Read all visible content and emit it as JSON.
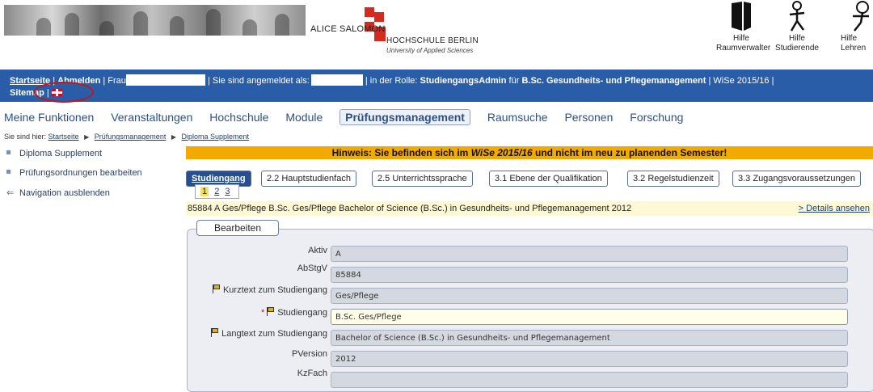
{
  "banner": {
    "logo_line1": "ALICE SALOMON",
    "logo_line2": "HOCHSCHULE BERLIN",
    "logo_line3": "University of Applied Sciences",
    "help_links": [
      {
        "line1": "Hilfe",
        "line2": "Raumverwalter",
        "icon": "raum-help-icon"
      },
      {
        "line1": "Hilfe",
        "line2": "Studierende",
        "icon": "student-help-icon"
      },
      {
        "line1": "Hilfe",
        "line2": "Lehren",
        "icon": "teacher-help-icon"
      }
    ]
  },
  "topbar": {
    "startseite": "Startseite",
    "sep": "|",
    "abmelden": "Abmelden",
    "frau": "Frau",
    "angemeldet": "Sie sind angemeldet als:",
    "rolle_prefix": "in der Rolle:",
    "rolle": "StudiengangsAdmin",
    "fuer": "für",
    "studiengang": "B.Sc. Gesundheits- und Pflegemanagement",
    "semester": "WiSe 2015/16",
    "sitemap": "Sitemap"
  },
  "mainnav": [
    "Meine Funktionen",
    "Veranstaltungen",
    "Hochschule",
    "Module",
    "Prüfungsmanagement",
    "Raumsuche",
    "Personen",
    "Forschung"
  ],
  "breadcrumb": {
    "prefix": "Sie sind hier:",
    "items": [
      "Startseite",
      "Prüfungsmanagement",
      "Diploma Supplement"
    ]
  },
  "sidebar": [
    {
      "label": "Diploma Supplement",
      "icon": "bullet-icon"
    },
    {
      "label": "Prüfungsordnungen bearbeiten",
      "icon": "bullet-icon"
    },
    {
      "label": "Navigation ausblenden",
      "icon": "arrow-left-icon"
    }
  ],
  "notice": {
    "prefix": "Hinweis: Sie befinden sich im",
    "semester": "WiSe 2015/16",
    "suffix": "und nicht im neu zu planenden Semester!"
  },
  "tabs": [
    "Studiengang",
    "2.2 Hauptstudienfach",
    "2.5 Unterrichtssprache",
    "3.1 Ebene der Qualifikation",
    "3.2 Regelstudienzeit",
    "3.3 Zugangsvoraussetzungen"
  ],
  "pager": [
    "1",
    "2",
    "3"
  ],
  "record": {
    "summary": "85884  A  Ges/Pflege  B.Sc. Ges/Pflege  Bachelor of Science (B.Sc.) in Gesundheits- und Pflegemanagement  2012",
    "details_link": "Details ansehen"
  },
  "form": {
    "edit_button": "Bearbeiten",
    "fields": [
      {
        "label": "Aktiv",
        "value": "A"
      },
      {
        "label": "AbStgV",
        "value": "85884"
      },
      {
        "label": "Kurztext zum Studiengang",
        "value": "Ges/Pflege"
      },
      {
        "label": "Studiengang",
        "value": "B.Sc. Ges/Pflege",
        "required": "*"
      },
      {
        "label": "Langtext zum Studiengang",
        "value": "Bachelor of Science (B.Sc.) in Gesundheits- und Pflegemanagement"
      },
      {
        "label": "PVersion",
        "value": "2012"
      },
      {
        "label": "KzFach",
        "value": ""
      }
    ]
  },
  "colors": {
    "bar": "#2a5da8",
    "notice": "#f2a900",
    "highlight": "#fdf9d4"
  }
}
